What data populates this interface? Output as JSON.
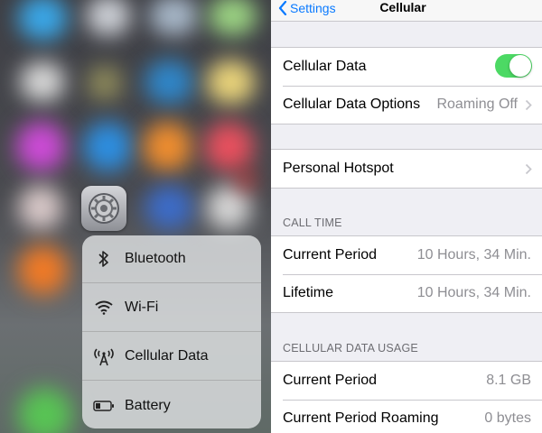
{
  "quick_actions": {
    "items": [
      {
        "label": "Bluetooth",
        "icon": "bluetooth-icon"
      },
      {
        "label": "Wi-Fi",
        "icon": "wifi-icon"
      },
      {
        "label": "Cellular Data",
        "icon": "cellular-antenna-icon"
      },
      {
        "label": "Battery",
        "icon": "battery-icon"
      }
    ]
  },
  "settings_app_icon": "gear-icon",
  "nav": {
    "back_label": "Settings",
    "title": "Cellular"
  },
  "cellular": {
    "cellular_data_label": "Cellular Data",
    "cellular_data_enabled": true,
    "options_label": "Cellular Data Options",
    "options_value": "Roaming Off",
    "hotspot_label": "Personal Hotspot"
  },
  "call_time": {
    "header": "CALL TIME",
    "current_period_label": "Current Period",
    "current_period_value": "10 Hours, 34 Min.",
    "lifetime_label": "Lifetime",
    "lifetime_value": "10 Hours, 34 Min."
  },
  "usage": {
    "header": "CELLULAR DATA USAGE",
    "current_period_label": "Current Period",
    "current_period_value": "8.1 GB",
    "roaming_label": "Current Period Roaming",
    "roaming_value": "0 bytes"
  },
  "colors": {
    "accent": "#0a7aff",
    "toggle_on": "#4cd964",
    "grouped_background": "#efeff4"
  }
}
